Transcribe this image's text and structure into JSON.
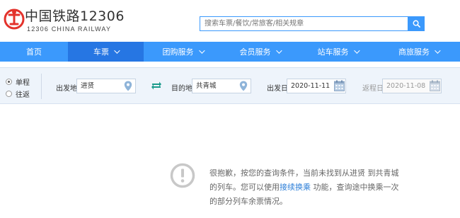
{
  "header": {
    "brand_cn": "中国铁路12306",
    "brand_en": "12306 CHINA RAILWAY",
    "search_placeholder": "搜索车票/餐饮/常旅客/相关规章"
  },
  "nav": {
    "items": [
      {
        "label": "首页",
        "dropdown": false,
        "active": false
      },
      {
        "label": "车票",
        "dropdown": true,
        "active": true
      },
      {
        "label": "团购服务",
        "dropdown": true,
        "active": false
      },
      {
        "label": "会员服务",
        "dropdown": true,
        "active": false
      },
      {
        "label": "站车服务",
        "dropdown": true,
        "active": false
      },
      {
        "label": "商旅服务",
        "dropdown": true,
        "active": false
      }
    ]
  },
  "query": {
    "trip_types": [
      {
        "label": "单程",
        "checked": true
      },
      {
        "label": "往返",
        "checked": false
      }
    ],
    "from_label": "出发地",
    "from_value": "进贤",
    "to_label": "目的地",
    "to_value": "共青城",
    "depart_label": "出发日",
    "depart_value": "2020-11-11",
    "return_label": "返程日",
    "return_value": "2020-11-08"
  },
  "message": {
    "line1": "很抱歉，按您的查询条件，当前未找到从进贤 到共青城",
    "line2_pre": "的列车。您可以使用",
    "line2_link": "接续换乘",
    "line2_post": " 功能，查询途中换乘一次",
    "line3": "的部分列车余票情况。"
  },
  "colors": {
    "primary": "#3b99fc",
    "nav_active": "#2676e3",
    "logo_red": "#e3322b",
    "query_bg": "#eef4fb",
    "link": "#2d7fd8"
  }
}
